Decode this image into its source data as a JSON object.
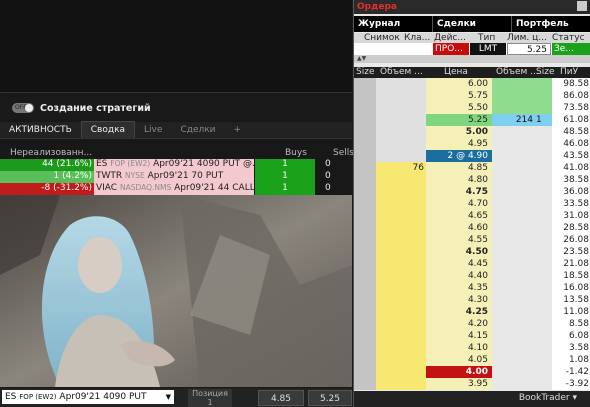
{
  "strategy_label": "Создание стратегий",
  "toggle_label": "OFF",
  "left_tabs": [
    {
      "label": "АКТИВНОСТЬ",
      "state": "active"
    },
    {
      "label": "Сводка",
      "state": "selected"
    },
    {
      "label": "Live",
      "state": "normal"
    },
    {
      "label": "Сделки",
      "state": "normal"
    },
    {
      "label": "+",
      "state": "normal"
    }
  ],
  "activity_headers": {
    "unrealized": "Нереализованн...",
    "buys": "Buys",
    "sells": "Sells"
  },
  "activity_rows": [
    {
      "pnl": "44 (21.6%)",
      "pnl_color": "#1c9a1c",
      "sym": "ES",
      "exch": "FOP (EW2)",
      "desc": "Apr09'21 4090 PUT @...",
      "buys": "1",
      "sells": "0"
    },
    {
      "pnl": "1 (4.2%)",
      "pnl_color": "#5abf5a",
      "sym": "TWTR",
      "exch": "NYSE",
      "desc": "Apr09'21 70 PUT",
      "buys": "1",
      "sells": "0"
    },
    {
      "pnl": "-8 (-31.2%)",
      "pnl_color": "#c01c1c",
      "sym": "VIAC",
      "exch": "NASDAQ.NMS",
      "desc": "Apr09'21 44 CALL",
      "buys": "1",
      "sells": "0"
    }
  ],
  "bottom_bar": {
    "symbol_sym": "ES",
    "symbol_exch": "FOP (EW2)",
    "symbol_desc": "Apr09'21 4090 PUT",
    "dropdown_icon": "chevron-down-icon",
    "position_label": "Позиция",
    "position_value": "1",
    "bid": "4.85",
    "ask": "5.25"
  },
  "right_title": "Ордера",
  "right_tabs": [
    "Журнал",
    "Сделки",
    "Портфель"
  ],
  "order_headers": [
    "Снимок",
    "Кла...",
    "Дейс...",
    "Тип",
    "Лим. ц...",
    "Статус"
  ],
  "order_row": {
    "action": "ПРО...",
    "type": "LMT",
    "limit": "5.25",
    "status": "Зе..."
  },
  "book_headers": [
    "Size",
    "Объем ...",
    "Цена",
    "Объем ...",
    "Size",
    "ПиУ"
  ],
  "book_rows": [
    {
      "price": "6.00",
      "bidvol": "",
      "askvol": "",
      "size": "",
      "pnl": "98.58",
      "price_bg": "#f4f0b8",
      "ask_bg": "#8fdc8f",
      "bid_bg": "#e0e0e0",
      "bold": false
    },
    {
      "price": "5.75",
      "bidvol": "",
      "askvol": "",
      "size": "",
      "pnl": "86.08",
      "price_bg": "#f4f0b8",
      "ask_bg": "#8fdc8f",
      "bid_bg": "#e0e0e0",
      "bold": false
    },
    {
      "price": "5.50",
      "bidvol": "",
      "askvol": "",
      "size": "",
      "pnl": "73.58",
      "price_bg": "#f4f0b8",
      "ask_bg": "#8fdc8f",
      "bid_bg": "#e0e0e0",
      "bold": false
    },
    {
      "price": "5.25",
      "bidvol": "",
      "askvol": "214",
      "size": "1",
      "pnl": "61.08",
      "price_bg": "#7fd67f",
      "ask_bg": "#7fd0ee",
      "bid_bg": "#e0e0e0",
      "bold": false
    },
    {
      "price": "5.00",
      "bidvol": "",
      "askvol": "",
      "size": "",
      "pnl": "48.58",
      "price_bg": "#f4f0b8",
      "ask_bg": "#e8e8e8",
      "bid_bg": "#e0e0e0",
      "bold": true
    },
    {
      "price": "4.95",
      "bidvol": "",
      "askvol": "",
      "size": "",
      "pnl": "46.08",
      "price_bg": "#f4f0b8",
      "ask_bg": "#e8e8e8",
      "bid_bg": "#e0e0e0",
      "bold": false
    },
    {
      "price": "2 @ 4.90",
      "bidvol": "",
      "askvol": "",
      "size": "",
      "pnl": "43.58",
      "price_bg": "#1b6e9e",
      "ask_bg": "#e8e8e8",
      "bid_bg": "#e0e0e0",
      "bold": false,
      "white": true
    },
    {
      "price": "4.85",
      "bidvol": "76",
      "askvol": "",
      "size": "",
      "pnl": "41.08",
      "price_bg": "#f4f0b8",
      "ask_bg": "#e8e8e8",
      "bid_bg": "#f6e870",
      "bold": false
    },
    {
      "price": "4.80",
      "bidvol": "",
      "askvol": "",
      "size": "",
      "pnl": "38.58",
      "price_bg": "#f4f0b8",
      "ask_bg": "#e8e8e8",
      "bid_bg": "#f6e870",
      "bold": false
    },
    {
      "price": "4.75",
      "bidvol": "",
      "askvol": "",
      "size": "",
      "pnl": "36.08",
      "price_bg": "#f4f0b8",
      "ask_bg": "#e8e8e8",
      "bid_bg": "#f6e870",
      "bold": true
    },
    {
      "price": "4.70",
      "bidvol": "",
      "askvol": "",
      "size": "",
      "pnl": "33.58",
      "price_bg": "#f4f0b8",
      "ask_bg": "#e8e8e8",
      "bid_bg": "#f6e870",
      "bold": false
    },
    {
      "price": "4.65",
      "bidvol": "",
      "askvol": "",
      "size": "",
      "pnl": "31.08",
      "price_bg": "#f4f0b8",
      "ask_bg": "#e8e8e8",
      "bid_bg": "#f6e870",
      "bold": false
    },
    {
      "price": "4.60",
      "bidvol": "",
      "askvol": "",
      "size": "",
      "pnl": "28.58",
      "price_bg": "#f4f0b8",
      "ask_bg": "#e8e8e8",
      "bid_bg": "#f6e870",
      "bold": false
    },
    {
      "price": "4.55",
      "bidvol": "",
      "askvol": "",
      "size": "",
      "pnl": "26.08",
      "price_bg": "#f4f0b8",
      "ask_bg": "#e8e8e8",
      "bid_bg": "#f6e870",
      "bold": false
    },
    {
      "price": "4.50",
      "bidvol": "",
      "askvol": "",
      "size": "",
      "pnl": "23.58",
      "price_bg": "#f4f0b8",
      "ask_bg": "#e8e8e8",
      "bid_bg": "#f6e870",
      "bold": true
    },
    {
      "price": "4.45",
      "bidvol": "",
      "askvol": "",
      "size": "",
      "pnl": "21.08",
      "price_bg": "#f4f0b8",
      "ask_bg": "#e8e8e8",
      "bid_bg": "#f6e870",
      "bold": false
    },
    {
      "price": "4.40",
      "bidvol": "",
      "askvol": "",
      "size": "",
      "pnl": "18.58",
      "price_bg": "#f4f0b8",
      "ask_bg": "#e8e8e8",
      "bid_bg": "#f6e870",
      "bold": false
    },
    {
      "price": "4.35",
      "bidvol": "",
      "askvol": "",
      "size": "",
      "pnl": "16.08",
      "price_bg": "#f4f0b8",
      "ask_bg": "#e8e8e8",
      "bid_bg": "#f6e870",
      "bold": false
    },
    {
      "price": "4.30",
      "bidvol": "",
      "askvol": "",
      "size": "",
      "pnl": "13.58",
      "price_bg": "#f4f0b8",
      "ask_bg": "#e8e8e8",
      "bid_bg": "#f6e870",
      "bold": false
    },
    {
      "price": "4.25",
      "bidvol": "",
      "askvol": "",
      "size": "",
      "pnl": "11.08",
      "price_bg": "#f4f0b8",
      "ask_bg": "#e8e8e8",
      "bid_bg": "#f6e870",
      "bold": true
    },
    {
      "price": "4.20",
      "bidvol": "",
      "askvol": "",
      "size": "",
      "pnl": "8.58",
      "price_bg": "#f4f0b8",
      "ask_bg": "#e8e8e8",
      "bid_bg": "#f6e870",
      "bold": false
    },
    {
      "price": "4.15",
      "bidvol": "",
      "askvol": "",
      "size": "",
      "pnl": "6.08",
      "price_bg": "#f4f0b8",
      "ask_bg": "#e8e8e8",
      "bid_bg": "#f6e870",
      "bold": false
    },
    {
      "price": "4.10",
      "bidvol": "",
      "askvol": "",
      "size": "",
      "pnl": "3.58",
      "price_bg": "#f4f0b8",
      "ask_bg": "#e8e8e8",
      "bid_bg": "#f6e870",
      "bold": false
    },
    {
      "price": "4.05",
      "bidvol": "",
      "askvol": "",
      "size": "",
      "pnl": "1.08",
      "price_bg": "#f4f0b8",
      "ask_bg": "#e8e8e8",
      "bid_bg": "#f6e870",
      "bold": false
    },
    {
      "price": "4.00",
      "bidvol": "",
      "askvol": "",
      "size": "",
      "pnl": "-1.42",
      "price_bg": "#c41010",
      "ask_bg": "#e8e8e8",
      "bid_bg": "#f6e870",
      "bold": true,
      "white": true
    },
    {
      "price": "3.95",
      "bidvol": "",
      "askvol": "",
      "size": "",
      "pnl": "-3.92",
      "price_bg": "#f4f0b8",
      "ask_bg": "#e8e8e8",
      "bid_bg": "#f6e870",
      "bold": false
    }
  ],
  "booktrader_label": "BookTrader",
  "booktrader_icon": "caret-down-icon"
}
